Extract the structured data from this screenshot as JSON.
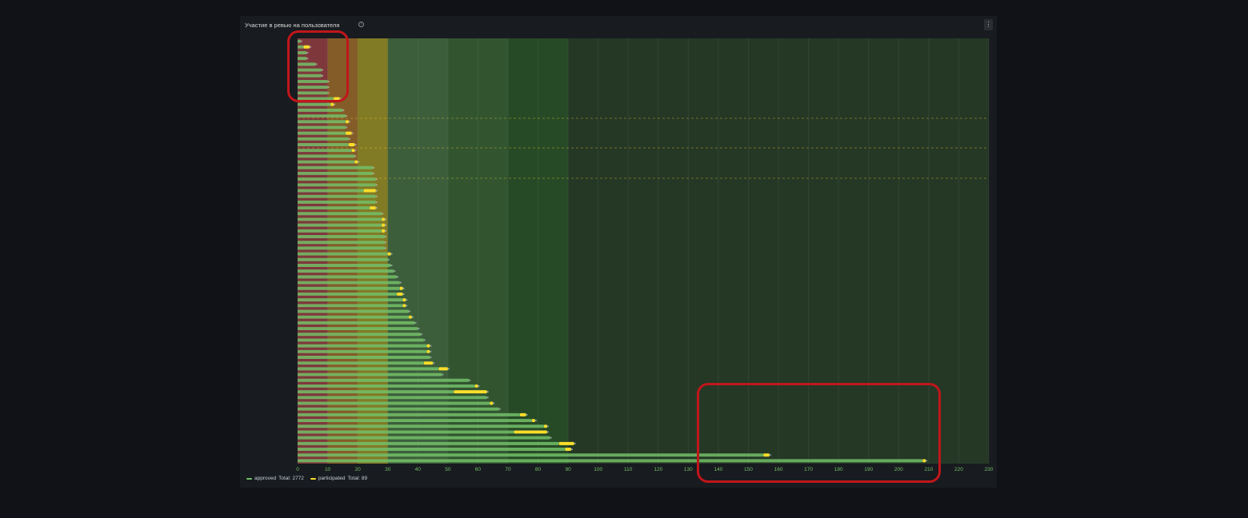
{
  "panel": {
    "title": "Участие в ревью на пользователя",
    "menu_icon": "kebab-menu-icon",
    "info_icon": "info-icon"
  },
  "colors": {
    "approved": "#73bf69",
    "participated": "#fade2a",
    "threshold_red": "#f2495c",
    "threshold_orange": "#ff9830",
    "threshold_yellow": "#fade2a",
    "threshold_green": "#73bf69",
    "threshold_darkgreen": "#37872d"
  },
  "legend": [
    {
      "name": "approved",
      "total_label": "Total: 2772",
      "color": "#73bf69"
    },
    {
      "name": "participated",
      "total_label": "Total: 89",
      "color": "#fade2a"
    }
  ],
  "chart_data": {
    "type": "bar",
    "orientation": "horizontal",
    "stacked": true,
    "x_ticks": [
      "0",
      "10",
      "20",
      "30",
      "40",
      "50",
      "60",
      "70",
      "80",
      "90",
      "100",
      "110",
      "120",
      "130",
      "140",
      "150",
      "160",
      "170",
      "180",
      "190",
      "200",
      "210",
      "220",
      "230"
    ],
    "xlim": [
      0,
      230
    ],
    "grid": true,
    "legend_position": "bottom-left",
    "thresholds": [
      {
        "from": 0,
        "to": 10,
        "color": "#f2495c"
      },
      {
        "from": 10,
        "to": 20,
        "color": "#ff9830"
      },
      {
        "from": 20,
        "to": 30,
        "color": "#fade2a"
      },
      {
        "from": 30,
        "to": 50,
        "color": "#73bf69"
      },
      {
        "from": 50,
        "to": 70,
        "color": "#56a64b"
      },
      {
        "from": 70,
        "to": 90,
        "color": "#37872d"
      },
      {
        "from": 90,
        "to": 230,
        "color": "#56a64b"
      }
    ],
    "series": [
      {
        "name": "approved",
        "values": [
          1,
          2,
          3,
          3,
          6,
          8,
          8,
          10,
          10,
          10,
          12,
          11,
          15,
          16,
          16,
          16,
          16,
          17,
          17,
          18,
          19,
          19,
          25,
          25,
          26,
          26,
          22,
          26,
          26,
          24,
          28,
          28,
          28,
          28,
          29,
          29,
          29,
          30,
          30,
          31,
          32,
          33,
          34,
          34,
          33,
          35,
          35,
          37,
          37,
          39,
          40,
          41,
          42,
          43,
          43,
          44,
          42,
          47,
          48,
          57,
          59,
          52,
          63,
          64,
          67,
          74,
          78,
          82,
          72,
          84,
          87,
          89,
          155,
          208
        ]
      },
      {
        "name": "participated",
        "values": [
          0,
          2,
          0,
          0,
          0,
          0,
          0,
          0,
          0,
          0,
          2,
          1,
          0,
          0,
          1,
          0,
          2,
          0,
          2,
          1,
          0,
          1,
          0,
          0,
          0,
          0,
          4,
          0,
          0,
          2,
          0,
          1,
          1,
          1,
          0,
          0,
          0,
          1,
          0,
          0,
          0,
          0,
          0,
          1,
          2,
          1,
          1,
          0,
          1,
          0,
          0,
          0,
          0,
          1,
          1,
          0,
          3,
          3,
          0,
          0,
          1,
          11,
          0,
          1,
          0,
          2,
          1,
          1,
          11,
          0,
          5,
          2,
          2,
          1
        ]
      }
    ]
  }
}
